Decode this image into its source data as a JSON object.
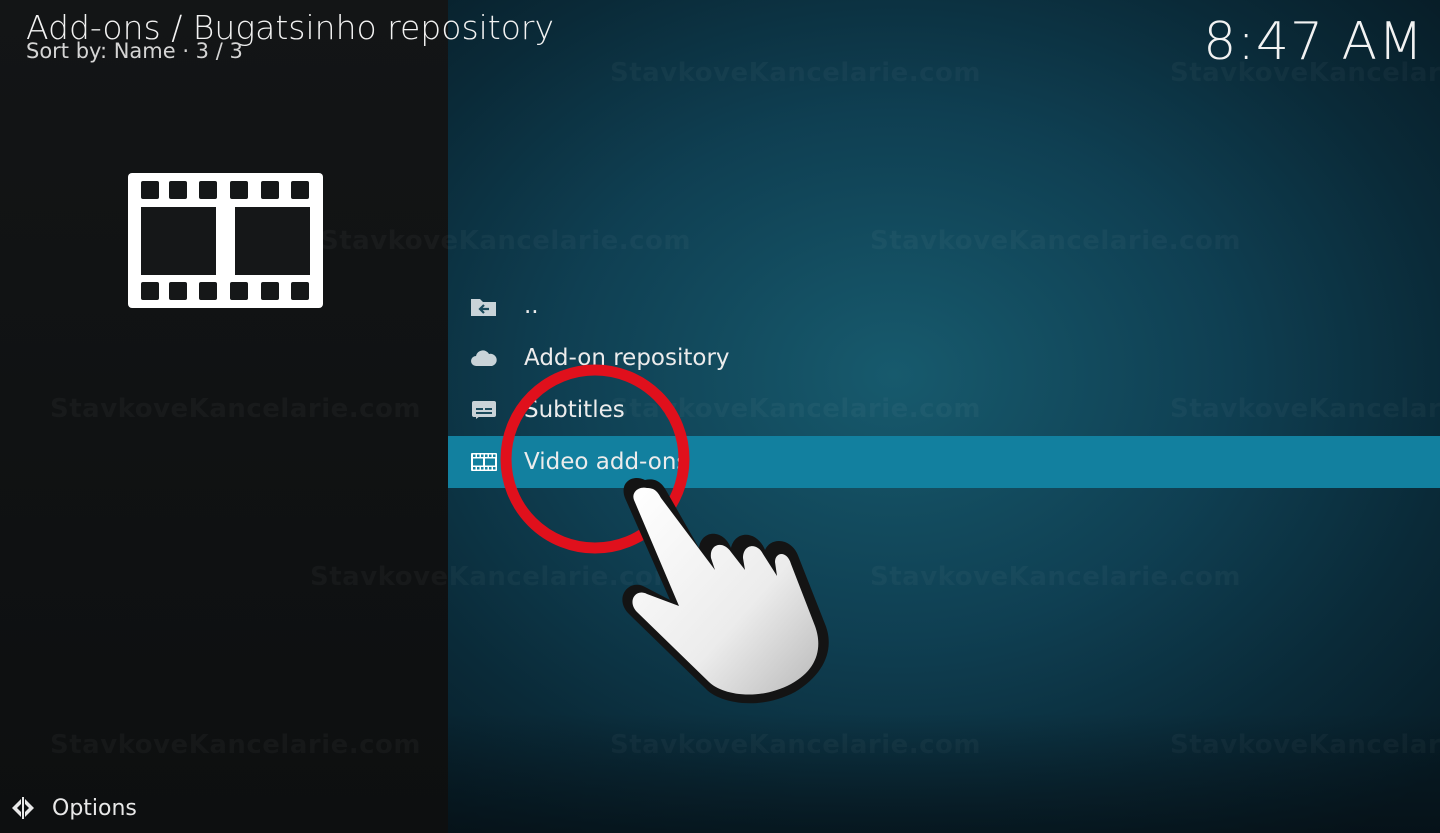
{
  "header": {
    "breadcrumb": "Add-ons /  Bugatsinho repository",
    "sort_info": "Sort by: Name  ·  3 / 3",
    "clock": "8:47 AM"
  },
  "hero": {
    "icon": "film-strip-icon"
  },
  "list": {
    "items": [
      {
        "label": "..",
        "icon": "folder-back-icon",
        "focused": false
      },
      {
        "label": "Add-on repository",
        "icon": "cloud-icon",
        "focused": false
      },
      {
        "label": "Subtitles",
        "icon": "subtitles-icon",
        "focused": false
      },
      {
        "label": "Video add-ons",
        "icon": "film-icon",
        "focused": true
      }
    ]
  },
  "footer": {
    "options_label": "Options",
    "options_icon": "options-arrows-icon"
  },
  "watermark": {
    "text": "StavkoveKancelarie.com"
  },
  "colors": {
    "focus_bar": "#12809f",
    "highlight_circle": "#e0101c",
    "left_panel": "#121415",
    "right_panel": "#0f3f52"
  }
}
